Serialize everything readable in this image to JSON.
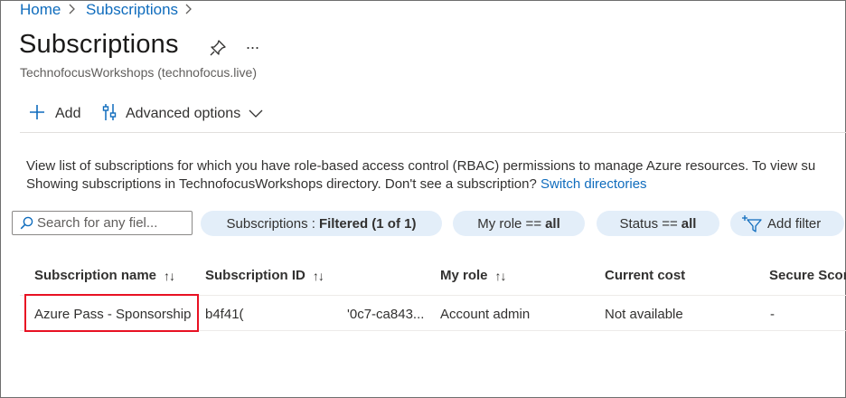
{
  "breadcrumb": {
    "items": [
      "Home",
      "Subscriptions"
    ]
  },
  "header": {
    "title": "Subscriptions",
    "subtitle": "TechnofocusWorkshops (technofocus.live)",
    "more_label": "..."
  },
  "toolbar": {
    "add_label": "Add",
    "advanced_label": "Advanced options"
  },
  "description": {
    "line1": "View list of subscriptions for which you have role-based access control (RBAC) permissions to manage Azure resources. To view su",
    "line2_prefix": "Showing subscriptions in TechnofocusWorkshops directory. Don't see a subscription?",
    "switch_link": "Switch directories"
  },
  "filters": {
    "search_placeholder": "Search for any fiel...",
    "subscriptions_label": "Subscriptions :",
    "subscriptions_value": "Filtered (1 of 1)",
    "role_label": "My role ==",
    "role_value": "all",
    "status_label": "Status ==",
    "status_value": "all",
    "add_filter_label": "Add filter"
  },
  "table": {
    "columns": [
      "Subscription name",
      "Subscription ID",
      "My role",
      "Current cost",
      "Secure Scor"
    ],
    "sort_glyph": "↑↓",
    "rows": [
      {
        "name": "Azure Pass - Sponsorship",
        "id_start": "b4f41(",
        "id_end": "'0c7-ca843...",
        "role": "Account admin",
        "cost": "Not available",
        "secure_score": "-"
      }
    ]
  }
}
